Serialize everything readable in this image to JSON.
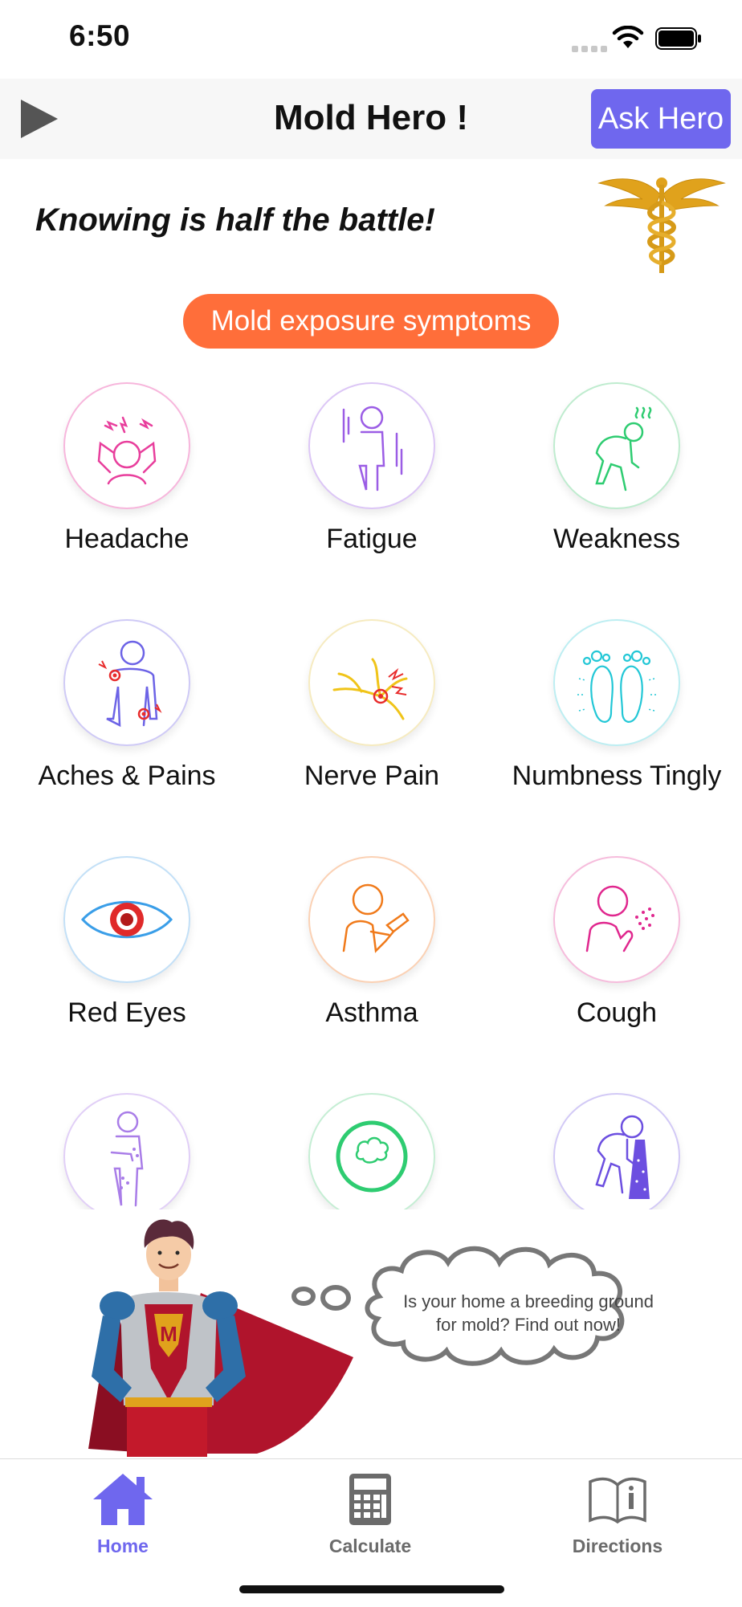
{
  "status_bar": {
    "time": "6:50"
  },
  "nav": {
    "title": "Mold Hero !",
    "ask_button": "Ask Hero"
  },
  "tagline": "Knowing is half the battle!",
  "section_button": "Mold exposure symptoms",
  "symptoms": [
    {
      "label": "Headache",
      "icon": "headache-icon",
      "color": "#e83e9c"
    },
    {
      "label": "Fatigue",
      "icon": "fatigue-icon",
      "color": "#9b5de5"
    },
    {
      "label": "Weakness",
      "icon": "weakness-icon",
      "color": "#2ecc71"
    },
    {
      "label": "Aches & Pains",
      "icon": "aches-pains-icon",
      "color": "#6c63e6"
    },
    {
      "label": "Nerve Pain",
      "icon": "nerve-pain-icon",
      "color": "#f0c419"
    },
    {
      "label": "Numbness Tingly",
      "icon": "numbness-icon",
      "color": "#22c7d6"
    },
    {
      "label": "Red Eyes",
      "icon": "eye-icon",
      "color": "#3a9ee8"
    },
    {
      "label": "Asthma",
      "icon": "asthma-icon",
      "color": "#f07a1a"
    },
    {
      "label": "Cough",
      "icon": "cough-icon",
      "color": "#e0278e"
    },
    {
      "label": "",
      "icon": "rash-icon",
      "color": "#a97de8"
    },
    {
      "label": "",
      "icon": "brain-fog-icon",
      "color": "#2ecc71"
    },
    {
      "label": "",
      "icon": "nausea-icon",
      "color": "#6c4fe0"
    }
  ],
  "banner": {
    "bubble_text": "Is your home a breeding ground for mold? Find out now!"
  },
  "tabs": [
    {
      "label": "Home",
      "icon": "home-icon",
      "active": true
    },
    {
      "label": "Calculate",
      "icon": "calculator-icon",
      "active": false
    },
    {
      "label": "Directions",
      "icon": "book-info-icon",
      "active": false
    }
  ],
  "colors": {
    "accent": "#6f67ee",
    "pill": "#ff6e3a",
    "gold": "#e0a21c",
    "tab_inactive": "#6b6b6b"
  }
}
